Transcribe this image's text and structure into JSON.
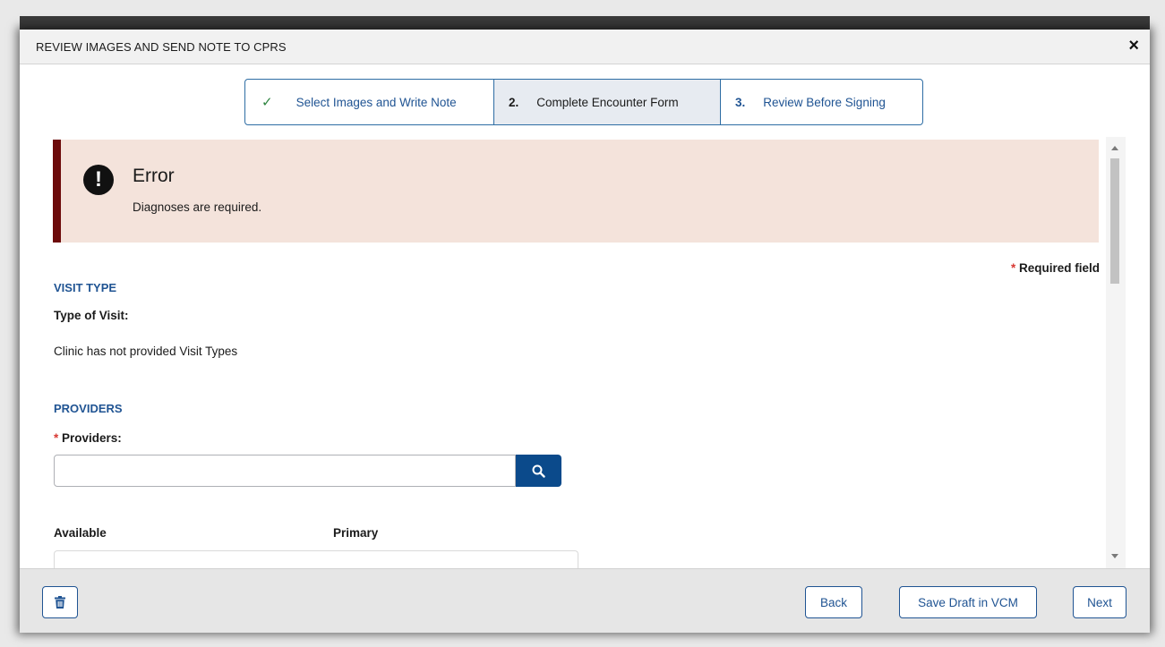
{
  "modal": {
    "title": "REVIEW IMAGES AND SEND NOTE TO CPRS",
    "close_symbol": "×"
  },
  "steps": [
    {
      "marker": "✓",
      "label": "Select Images and Write Note",
      "state": "complete"
    },
    {
      "marker": "2.",
      "label": "Complete Encounter Form",
      "state": "current"
    },
    {
      "marker": "3.",
      "label": "Review Before Signing",
      "state": "upcoming"
    }
  ],
  "alert": {
    "icon": "error-icon",
    "symbol": "!",
    "title": "Error",
    "message": "Diagnoses are required.",
    "accent_color": "#6d0a0a",
    "background_color": "#f4e3db"
  },
  "required_note": {
    "star": "*",
    "text": "Required field"
  },
  "visit_type": {
    "heading": "VISIT TYPE",
    "label": "Type of Visit:",
    "message": "Clinic has not provided Visit Types"
  },
  "providers": {
    "heading": "PROVIDERS",
    "required_star": "*",
    "label": "Providers:",
    "input_value": "",
    "search_icon": "search-icon",
    "columns": [
      "Available",
      "Primary"
    ]
  },
  "footer": {
    "delete_icon": "trash-icon",
    "back_label": "Back",
    "save_label": "Save Draft in VCM",
    "next_label": "Next"
  },
  "colors": {
    "primary": "#205493",
    "search_button": "#0b4a8b",
    "required_star": "#d83933",
    "complete_check": "#2e8540"
  }
}
